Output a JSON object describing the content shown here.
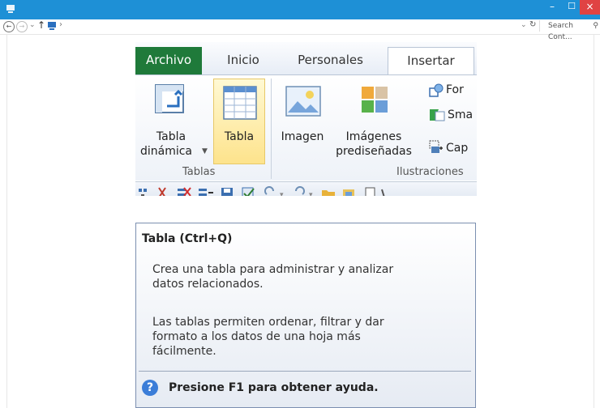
{
  "window": {
    "min_label": "–",
    "max_label": "☐",
    "close_label": "×"
  },
  "address_bar": {
    "search_placeholder": "Search Cont..."
  },
  "ribbon": {
    "tabs": {
      "archivo": "Archivo",
      "inicio": "Inicio",
      "personales": "Personales",
      "insertar": "Insertar"
    },
    "groups": {
      "tablas": {
        "label": "Tablas",
        "tabla_dinamica_line1": "Tabla",
        "tabla_dinamica_line2": "dinámica",
        "tabla": "Tabla"
      },
      "ilustraciones": {
        "label": "Ilustraciones",
        "imagen": "Imagen",
        "imagenes_line1": "Imágenes",
        "imagenes_line2": "prediseñadas",
        "formas": "For",
        "smartart": "Sma",
        "captura": "Cap"
      }
    }
  },
  "tooltip": {
    "title": "Tabla (Ctrl+Q)",
    "description": "Crea una tabla para administrar y analizar\ndatos relacionados.",
    "detail": "Las tablas permiten ordenar, filtrar y dar\nformato a los datos de una hoja más\nfácilmente.",
    "help": "Presione F1 para obtener ayuda."
  }
}
